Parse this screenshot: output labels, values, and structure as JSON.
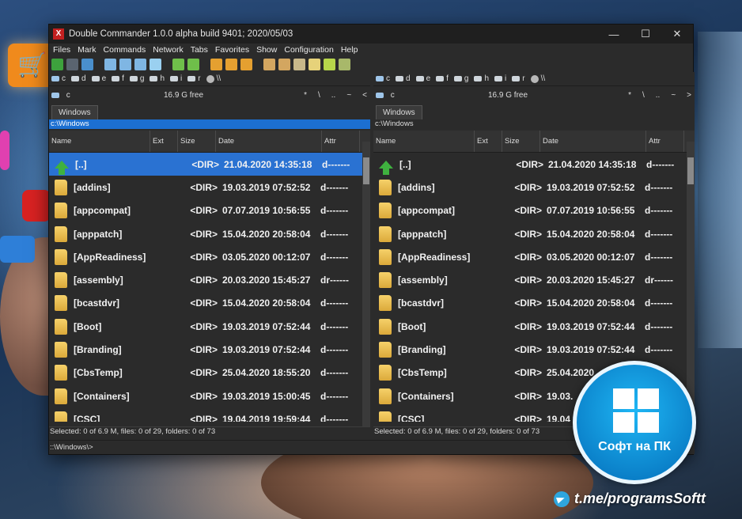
{
  "window": {
    "title": "Double Commander 1.0.0 alpha build 9401; 2020/05/03",
    "min_label": "—",
    "max_label": "☐",
    "close_label": "✕"
  },
  "menu": [
    "Files",
    "Mark",
    "Commands",
    "Network",
    "Tabs",
    "Favorites",
    "Show",
    "Configuration",
    "Help"
  ],
  "drives": [
    "c",
    "d",
    "e",
    "f",
    "g",
    "h",
    "i",
    "r",
    "\\\\"
  ],
  "left": {
    "drive": "c",
    "free": "16.9 G free",
    "nav": [
      "*",
      "\\",
      "..",
      "~",
      "<"
    ],
    "tab": "Windows",
    "path": "c:\\Windows",
    "status": "Selected: 0 of 6.9 M, files: 0 of 29, folders: 0 of 73"
  },
  "right": {
    "drive": "c",
    "free": "16.9 G free",
    "nav": [
      "*",
      "\\",
      "..",
      "~",
      ">"
    ],
    "tab": "Windows",
    "path": "c:\\Windows",
    "status": "Selected: 0 of 6.9 M, files: 0 of 29, folders: 0 of 73"
  },
  "columns": {
    "name": "Name",
    "ext": "Ext",
    "size": "Size",
    "date": "Date",
    "attr": "Attr"
  },
  "left_rows": [
    {
      "name": "[..]",
      "size": "<DIR>",
      "date": "21.04.2020 14:35:18",
      "attr": "d-------"
    },
    {
      "name": "[addins]",
      "size": "<DIR>",
      "date": "19.03.2019 07:52:52",
      "attr": "d-------"
    },
    {
      "name": "[appcompat]",
      "size": "<DIR>",
      "date": "07.07.2019 10:56:55",
      "attr": "d-------"
    },
    {
      "name": "[apppatch]",
      "size": "<DIR>",
      "date": "15.04.2020 20:58:04",
      "attr": "d-------"
    },
    {
      "name": "[AppReadiness]",
      "size": "<DIR>",
      "date": "03.05.2020 00:12:07",
      "attr": "d-------"
    },
    {
      "name": "[assembly]",
      "size": "<DIR>",
      "date": "20.03.2020 15:45:27",
      "attr": "dr------"
    },
    {
      "name": "[bcastdvr]",
      "size": "<DIR>",
      "date": "15.04.2020 20:58:04",
      "attr": "d-------"
    },
    {
      "name": "[Boot]",
      "size": "<DIR>",
      "date": "19.03.2019 07:52:44",
      "attr": "d-------"
    },
    {
      "name": "[Branding]",
      "size": "<DIR>",
      "date": "19.03.2019 07:52:44",
      "attr": "d-------"
    },
    {
      "name": "[CbsTemp]",
      "size": "<DIR>",
      "date": "25.04.2020 18:55:20",
      "attr": "d-------"
    },
    {
      "name": "[Containers]",
      "size": "<DIR>",
      "date": "19.03.2019 15:00:45",
      "attr": "d-------"
    },
    {
      "name": "[CSC]",
      "size": "<DIR>",
      "date": "19.04.2019 19:59:44",
      "attr": "d-------"
    }
  ],
  "right_rows": [
    {
      "name": "[..]",
      "size": "<DIR>",
      "date": "21.04.2020 14:35:18",
      "attr": "d-------"
    },
    {
      "name": "[addins]",
      "size": "<DIR>",
      "date": "19.03.2019 07:52:52",
      "attr": "d-------"
    },
    {
      "name": "[appcompat]",
      "size": "<DIR>",
      "date": "07.07.2019 10:56:55",
      "attr": "d-------"
    },
    {
      "name": "[apppatch]",
      "size": "<DIR>",
      "date": "15.04.2020 20:58:04",
      "attr": "d-------"
    },
    {
      "name": "[AppReadiness]",
      "size": "<DIR>",
      "date": "03.05.2020 00:12:07",
      "attr": "d-------"
    },
    {
      "name": "[assembly]",
      "size": "<DIR>",
      "date": "20.03.2020 15:45:27",
      "attr": "dr------"
    },
    {
      "name": "[bcastdvr]",
      "size": "<DIR>",
      "date": "15.04.2020 20:58:04",
      "attr": "d-------"
    },
    {
      "name": "[Boot]",
      "size": "<DIR>",
      "date": "19.03.2019 07:52:44",
      "attr": "d-------"
    },
    {
      "name": "[Branding]",
      "size": "<DIR>",
      "date": "19.03.2019 07:52:44",
      "attr": "d-------"
    },
    {
      "name": "[CbsTemp]",
      "size": "<DIR>",
      "date": "25.04.2020",
      "attr": ""
    },
    {
      "name": "[Containers]",
      "size": "<DIR>",
      "date": "19.03.",
      "attr": ""
    },
    {
      "name": "[CSC]",
      "size": "<DIR>",
      "date": "19.04",
      "attr": ""
    }
  ],
  "command_line": "::\\Windows\\>",
  "badge": {
    "text": "Софт на ПК"
  },
  "watermark": {
    "text": "t.me/programsSoftt"
  },
  "colors": {
    "selection": "#2a72d2",
    "path_active": "#1c6fd1",
    "badge": "#1fb6f4"
  }
}
